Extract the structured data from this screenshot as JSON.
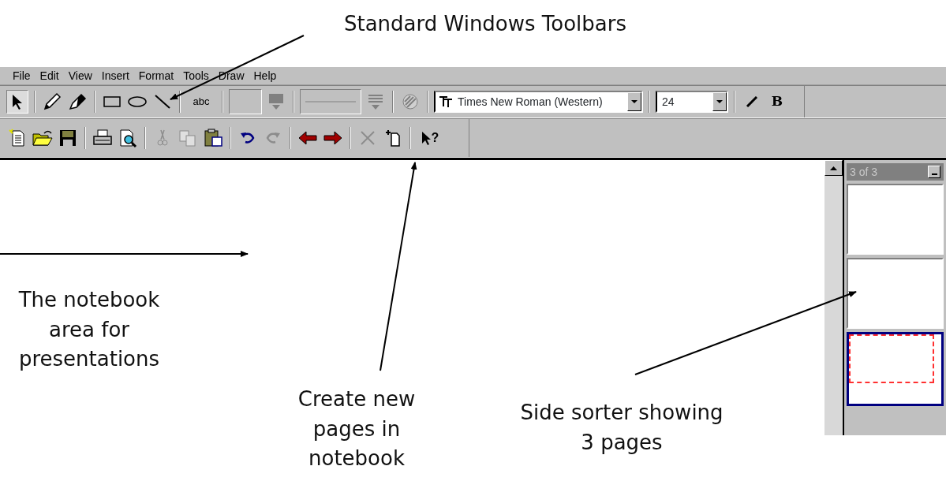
{
  "annotations": [
    {
      "text": "Standard Windows Toolbars"
    },
    {
      "text": "The notebook area for presentations"
    },
    {
      "text": "Create new pages in notebook"
    },
    {
      "text": "Side sorter showing 3 pages"
    }
  ],
  "menu": [
    {
      "label": "File"
    },
    {
      "label": "Edit"
    },
    {
      "label": "View"
    },
    {
      "label": "Insert"
    },
    {
      "label": "Format"
    },
    {
      "label": "Tools"
    },
    {
      "label": "Draw"
    },
    {
      "label": "Help"
    }
  ],
  "toolbar_1": [
    {
      "kind": "pointer",
      "selected": true
    },
    {
      "kind": "separator"
    },
    {
      "kind": "pen",
      "selected": false
    },
    {
      "kind": "highlighter",
      "selected": false
    },
    {
      "kind": "separator"
    },
    {
      "kind": "rectangle",
      "selected": false
    },
    {
      "kind": "ellipse",
      "selected": false
    },
    {
      "kind": "line",
      "selected": false
    },
    {
      "kind": "separator"
    },
    {
      "kind": "text",
      "label": "abc"
    },
    {
      "kind": "separator"
    },
    {
      "kind": "swatch"
    },
    {
      "kind": "fill-dropdown"
    },
    {
      "kind": "separator"
    },
    {
      "kind": "line-swatch"
    },
    {
      "kind": "line-dropdown"
    },
    {
      "kind": "separator"
    },
    {
      "kind": "transparency"
    },
    {
      "kind": "separator"
    },
    {
      "kind": "font-combo",
      "value": "Times New Roman (Western)"
    },
    {
      "kind": "separator"
    },
    {
      "kind": "size-combo",
      "value": "24"
    },
    {
      "kind": "separator"
    },
    {
      "kind": "italic"
    },
    {
      "kind": "bold",
      "label": "B"
    }
  ],
  "toolbar_2": [
    {
      "kind": "new",
      "disabled": false
    },
    {
      "kind": "open",
      "disabled": false
    },
    {
      "kind": "save",
      "disabled": false
    },
    {
      "kind": "separator"
    },
    {
      "kind": "print",
      "disabled": false
    },
    {
      "kind": "preview",
      "disabled": false
    },
    {
      "kind": "separator"
    },
    {
      "kind": "cut",
      "disabled": true
    },
    {
      "kind": "copy",
      "disabled": true
    },
    {
      "kind": "paste",
      "disabled": false
    },
    {
      "kind": "separator"
    },
    {
      "kind": "undo",
      "disabled": false
    },
    {
      "kind": "redo",
      "disabled": true
    },
    {
      "kind": "separator"
    },
    {
      "kind": "back",
      "disabled": false
    },
    {
      "kind": "forward",
      "disabled": false
    },
    {
      "kind": "separator"
    },
    {
      "kind": "delete",
      "disabled": true
    },
    {
      "kind": "add-page",
      "disabled": false
    },
    {
      "kind": "separator"
    },
    {
      "kind": "help",
      "label": "?",
      "disabled": false
    }
  ],
  "sorter": {
    "title": "3 of 3",
    "pages": [
      {
        "selected": false
      },
      {
        "selected": false
      },
      {
        "selected": true
      }
    ]
  }
}
